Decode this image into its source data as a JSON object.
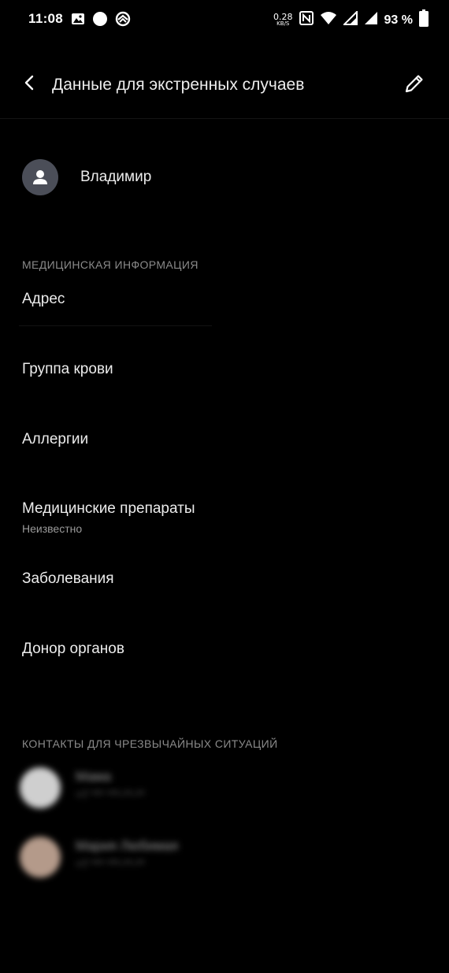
{
  "status_bar": {
    "time": "11:08",
    "net_speed_value": "0.28",
    "net_speed_unit": "KB/S",
    "battery": "93 %",
    "icons": [
      "image-icon",
      "circle-icon",
      "sync-icon",
      "nfc-icon",
      "wifi-icon",
      "signal-icon",
      "signal-icon",
      "battery-icon"
    ]
  },
  "app_bar": {
    "title": "Данные для экстренных случаев",
    "back_icon": "back-arrow-icon",
    "edit_icon": "pencil-icon"
  },
  "profile": {
    "name": "Владимир",
    "avatar_icon": "person-icon",
    "avatar_color": "#4b4e58"
  },
  "medical": {
    "header": "МЕДИЦИНСКАЯ ИНФОРМАЦИЯ",
    "items": [
      {
        "title": "Адрес",
        "subtitle": ""
      },
      {
        "title": "Группа крови",
        "subtitle": ""
      },
      {
        "title": "Аллергии",
        "subtitle": ""
      },
      {
        "title": "Медицинские препараты",
        "subtitle": "Неизвестно"
      },
      {
        "title": "Заболевания",
        "subtitle": ""
      },
      {
        "title": "Донор органов",
        "subtitle": ""
      }
    ]
  },
  "contacts": {
    "header": "КОНТАКТЫ ДЛЯ ЧРЕЗВЫЧАЙНЫХ СИТУАЦИЙ",
    "items": [
      {
        "name": "Мама",
        "phone": "+7 *** ***-**-**",
        "avatar_color": "#cfcfcf"
      },
      {
        "name": "Мария Любимая",
        "phone": "+7 *** ***-**-**",
        "avatar_color": "#b49a8a"
      }
    ]
  }
}
